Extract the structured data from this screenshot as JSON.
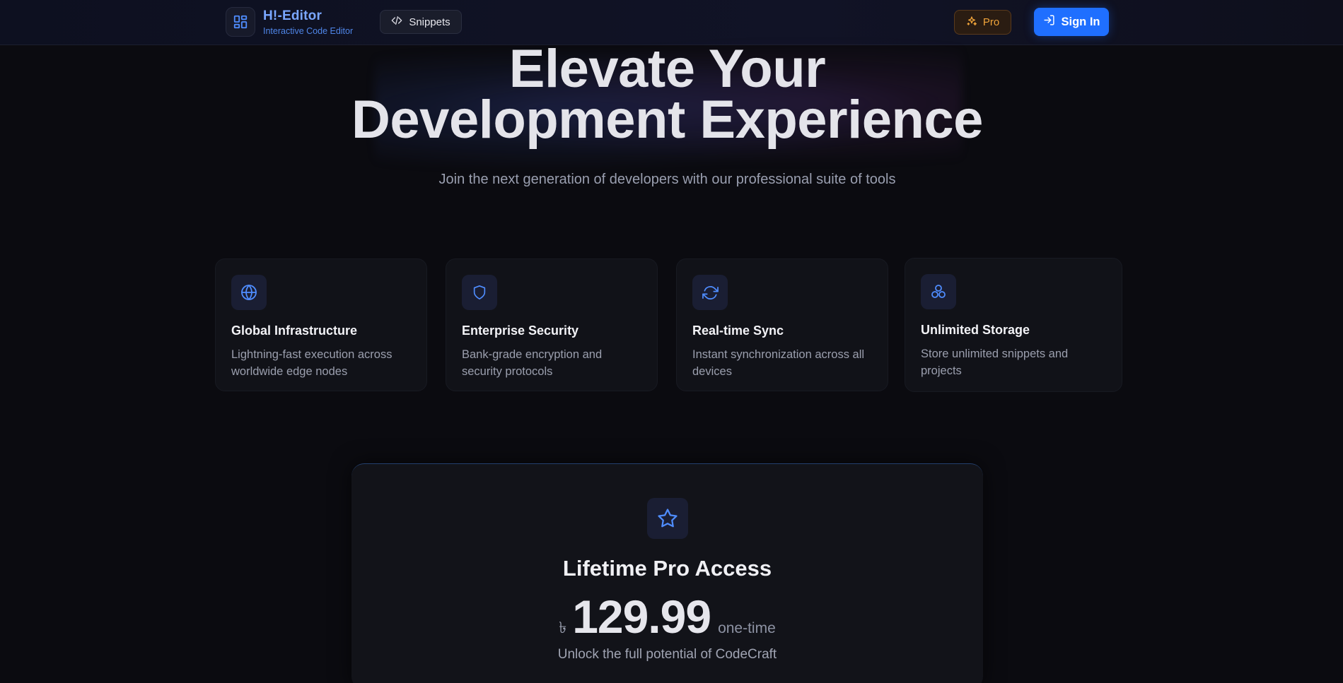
{
  "header": {
    "brand_title": "H!-Editor",
    "brand_subtitle": "Interactive Code Editor",
    "logo_icon": "layout-grid-icon",
    "snippets_label": "Snippets",
    "pro_label": "Pro",
    "signin_label": "Sign In"
  },
  "hero": {
    "title_line1": "Elevate Your",
    "title_line2": "Development Experience",
    "subtitle": "Join the next generation of developers with our professional suite of tools"
  },
  "features": [
    {
      "icon": "globe-icon",
      "title": "Global Infrastructure",
      "description": "Lightning-fast execution across worldwide edge nodes"
    },
    {
      "icon": "shield-icon",
      "title": "Enterprise Security",
      "description": "Bank-grade encryption and security protocols"
    },
    {
      "icon": "refresh-icon",
      "title": "Real-time Sync",
      "description": "Instant synchronization across all devices"
    },
    {
      "icon": "boxes-icon",
      "title": "Unlimited Storage",
      "description": "Store unlimited snippets and projects"
    }
  ],
  "pricing": {
    "title": "Lifetime Pro Access",
    "currency": "৳",
    "price": "129.99",
    "period": "one-time",
    "subtitle": "Unlock the full potential of CodeCraft"
  },
  "colors": {
    "accent": "#1f6fff",
    "brand": "#7aa7ff",
    "pro": "#f0a43a",
    "background": "#0b0b10"
  }
}
